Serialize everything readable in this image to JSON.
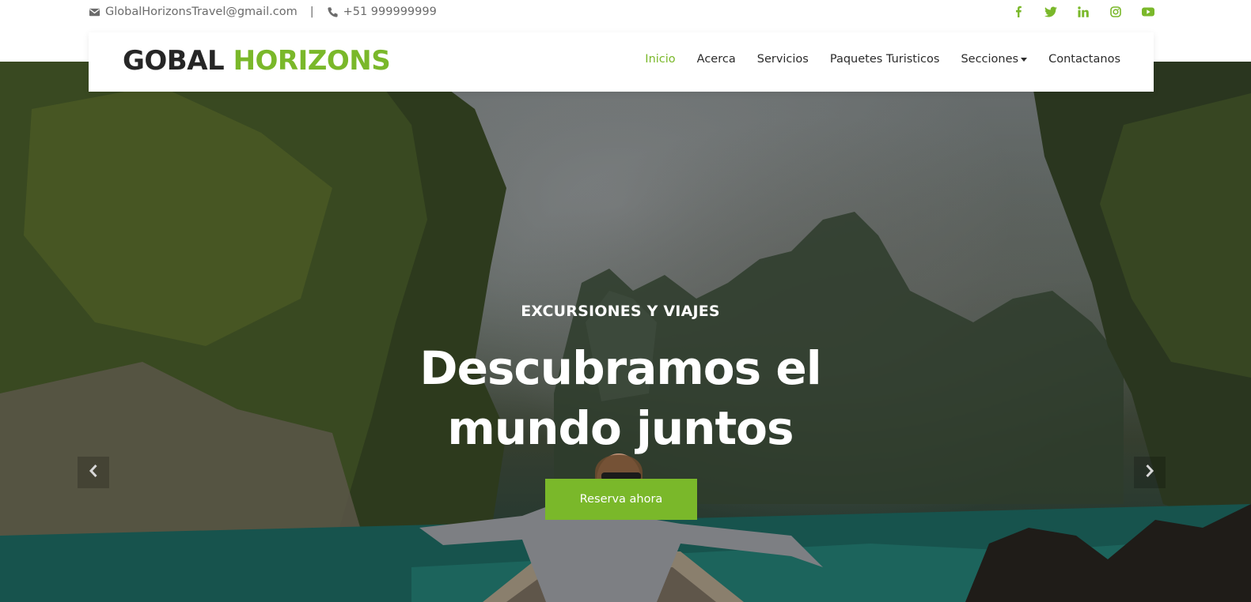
{
  "topbar": {
    "email": "GlobalHorizonsTravel@gmail.com",
    "separator": "|",
    "phone": "+51 999999999",
    "email_icon": "envelope-icon",
    "phone_icon": "phone-icon",
    "social": [
      "facebook-icon",
      "twitter-icon",
      "linkedin-icon",
      "instagram-icon",
      "youtube-icon"
    ]
  },
  "brand": {
    "part1": "GOBAL",
    "part2": "HORIZONS"
  },
  "nav": {
    "items": [
      "Inicio",
      "Acerca",
      "Servicios",
      "Paquetes Turisticos",
      "Secciones",
      "Contactanos"
    ],
    "active": "Inicio"
  },
  "hero": {
    "eyebrow": "EXCURSIONES Y VIAJES",
    "headline_line1": "Descubramos el",
    "headline_line2": "mundo juntos",
    "cta": "Reserva ahora",
    "prev_icon": "chevron-left-icon",
    "next_icon": "chevron-right-icon"
  },
  "colors": {
    "accent": "#7ab82a",
    "text_dark": "#262626",
    "text_muted": "#6b6b6b"
  }
}
